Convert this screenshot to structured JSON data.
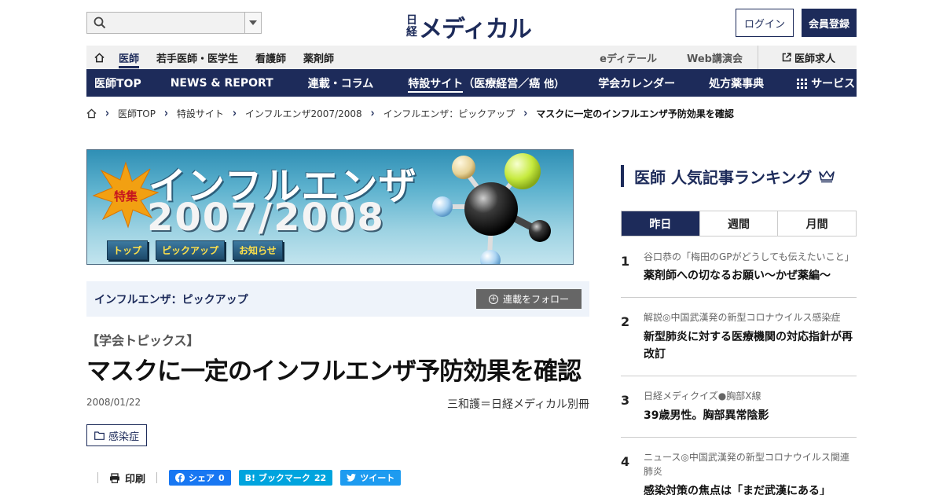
{
  "header": {
    "search": {
      "placeholder": "",
      "value": ""
    },
    "logo": {
      "small_top": "日",
      "small_bottom": "経",
      "main": "メディカル"
    },
    "login_label": "ログイン",
    "register_label": "会員登録"
  },
  "subnav": {
    "items": [
      "医師",
      "若手医師・医学生",
      "看護師",
      "薬剤師"
    ],
    "active_index": 0,
    "right_items": [
      "eディテール",
      "Web講演会"
    ],
    "job_label": "医師求人"
  },
  "mainnav": {
    "items": [
      "医師TOP",
      "NEWS & REPORT",
      "連載・コラム"
    ],
    "special_label": "特設サイト",
    "special_sub": "（医療経営／癌",
    "special_more": "他）",
    "calendar_label": "学会カレンダー",
    "drugs_label": "処方薬事典",
    "service_label": "サービス"
  },
  "breadcrumb": [
    "医師TOP",
    "特設サイト",
    "インフルエンザ2007/2008",
    "インフルエンザ：ピックアップ",
    "マスクに一定のインフルエンザ予防効果を確認"
  ],
  "banner": {
    "badge": "特集",
    "title_line1": "インフルエンザ",
    "title_line2": "2007/2008",
    "buttons": [
      "トップ",
      "ピックアップ",
      "お知らせ"
    ]
  },
  "series": {
    "name": "インフルエンザ：ピックアップ",
    "follow_label": "連載をフォロー"
  },
  "article": {
    "kicker": "【学会トピックス】",
    "headline": "マスクに一定のインフルエンザ予防効果を確認",
    "date": "2008/01/22",
    "author": "三和護＝日経メディカル別冊",
    "tag": "感染症"
  },
  "share": {
    "print_label": "印刷",
    "facebook_label": "シェア",
    "facebook_count": "0",
    "hatena_label": "B! ブックマーク",
    "hatena_count": "22",
    "twitter_label": "ツイート"
  },
  "ranking": {
    "title": "医師 人気記事ランキング",
    "tabs": [
      "昨日",
      "週間",
      "月間"
    ],
    "active_tab": 0,
    "items": [
      {
        "rank": "1",
        "category": "谷口恭の「梅田のGPがどうしても伝えたいこと」",
        "title": "薬剤師への切なるお願い～かぜ薬編～"
      },
      {
        "rank": "2",
        "category": "解説◎中国武漢発の新型コロナウイルス感染症",
        "title": "新型肺炎に対する医療機関の対応指針が再改訂"
      },
      {
        "rank": "3",
        "category": "日経メディクイズ●胸部X線",
        "title": "39歳男性。胸部異常陰影"
      },
      {
        "rank": "4",
        "category": "ニュース◎中国武漢発の新型コロナウイルス関連肺炎",
        "title": "感染対策の焦点は「まだ武漢にある」"
      }
    ]
  },
  "colors": {
    "brand": "#1d2b5a",
    "follow_button": "#666666",
    "facebook": "#1877f2",
    "hatena": "#00a4de",
    "twitter": "#1d9bf0"
  }
}
